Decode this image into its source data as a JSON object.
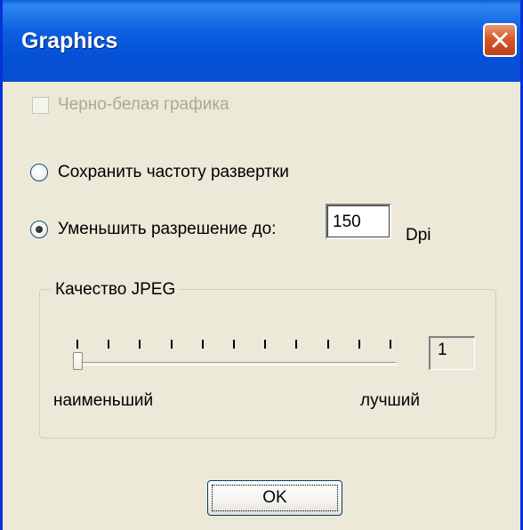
{
  "window": {
    "title": "Graphics"
  },
  "options": {
    "bw_label": "Черно-белая графика",
    "bw_checked": false,
    "bw_enabled": false,
    "keep_rate_label": "Сохранить частоту развертки",
    "reduce_res_label": "Уменьшить разрешение до:",
    "selected": "reduce_res",
    "dpi_value": "150",
    "dpi_unit": "Dpi"
  },
  "jpeg": {
    "legend": "Качество JPEG",
    "value": "1",
    "min_label": "наименьший",
    "max_label": "лучший",
    "tick_count": 11,
    "level_fraction": 0
  },
  "buttons": {
    "ok_label": "OK"
  },
  "icons": {
    "close": "close-icon"
  },
  "colors": {
    "titlebar": "#0b5ee0",
    "close_button": "#d45a2a",
    "dialog_bg": "#ece9d8",
    "disabled_text": "#aca899"
  }
}
